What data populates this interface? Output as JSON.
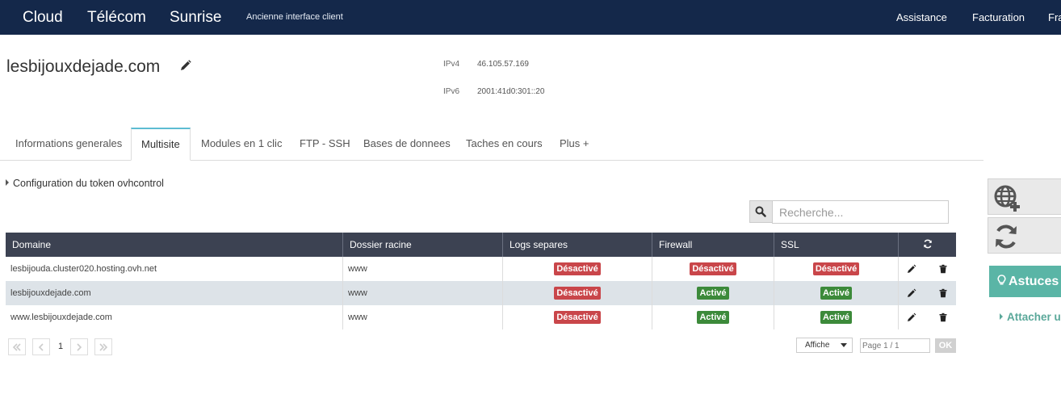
{
  "topnav": {
    "cloud": "Cloud",
    "telecom": "Télécom",
    "sunrise": "Sunrise",
    "old_interface": "Ancienne interface client",
    "assistance": "Assistance",
    "facturation": "Facturation",
    "language": "Fra"
  },
  "header": {
    "domain": "lesbijouxdejade.com",
    "ipv4_label": "IPv4",
    "ipv4": "46.105.57.169",
    "ipv6_label": "IPv6",
    "ipv6": "2001:41d0:301::20"
  },
  "tabs": {
    "infos": "Informations generales",
    "multisite": "Multisite",
    "modules": "Modules en 1 clic",
    "ftp": "FTP - SSH",
    "bases": "Bases de donnees",
    "taches": "Taches en cours",
    "plus": "Plus +"
  },
  "token_config": "Configuration du token ovhcontrol",
  "search": {
    "placeholder": "Recherche..."
  },
  "table": {
    "headers": {
      "domaine": "Domaine",
      "dossier": "Dossier racine",
      "logs": "Logs separes",
      "firewall": "Firewall",
      "ssl": "SSL"
    },
    "rows": [
      {
        "domaine": "lesbijouda.cluster020.hosting.ovh.net",
        "dossier": "www",
        "logs": "Désactivé",
        "firewall": "Désactivé",
        "ssl": "Désactivé"
      },
      {
        "domaine": "lesbijouxdejade.com",
        "dossier": "www",
        "logs": "Désactivé",
        "firewall": "Activé",
        "ssl": "Activé"
      },
      {
        "domaine": "www.lesbijouxdejade.com",
        "dossier": "www",
        "logs": "Désactivé",
        "firewall": "Activé",
        "ssl": "Activé"
      }
    ]
  },
  "pagination": {
    "current_page": "1",
    "affiche": "Affiche",
    "page_field": "Page 1 / 1",
    "ok": "OK"
  },
  "sidebar": {
    "astuces": "Astuces",
    "attacher": "Attacher u"
  },
  "colors": {
    "navbar": "#14284a",
    "table_header": "#3c4252",
    "badge_off": "#c9464a",
    "badge_on": "#3c8a3a",
    "accent_teal": "#5ab5a6",
    "tab_accent": "#5dbcd2"
  },
  "icons": {
    "edit": "pencil-icon",
    "search": "search-icon",
    "refresh": "refresh-icon",
    "delete": "trash-icon",
    "globe_add": "globe-add-icon",
    "sync": "sync-icon",
    "tip": "lightbulb-icon"
  }
}
